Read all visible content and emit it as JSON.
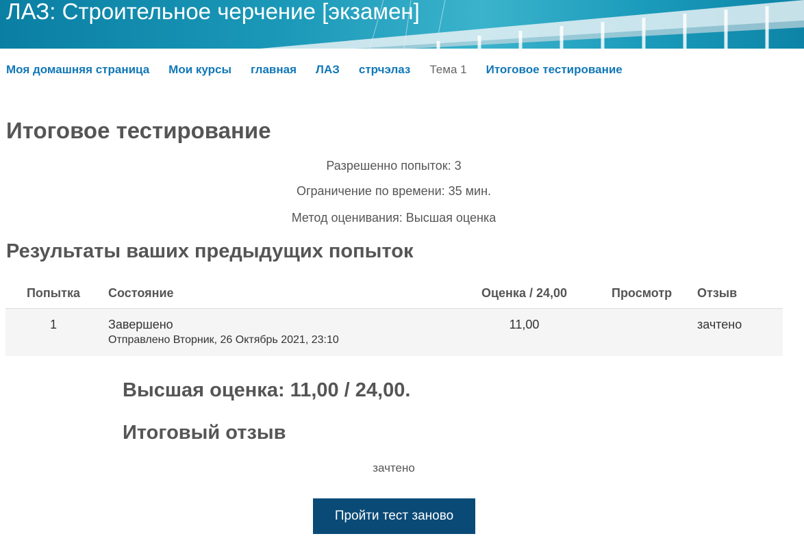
{
  "header": {
    "course_title": "ЛАЗ: Строительное черчение [экзамен]"
  },
  "breadcrumb": [
    {
      "label": "Моя домашняя страница",
      "link": true
    },
    {
      "label": "Мои курсы",
      "link": true
    },
    {
      "label": "главная",
      "link": true
    },
    {
      "label": "ЛАЗ",
      "link": true
    },
    {
      "label": "стрчэлаз",
      "link": true
    },
    {
      "label": "Тема 1",
      "link": false
    },
    {
      "label": "Итоговое тестирование",
      "link": true
    }
  ],
  "page": {
    "title": "Итоговое тестирование",
    "info": {
      "attempts_allowed": "Разрешенно попыток: 3",
      "time_limit": "Ограничение по времени: 35 мин.",
      "grading_method": "Метод оценивания: Высшая оценка"
    }
  },
  "results": {
    "title": "Результаты ваших предыдущих попыток",
    "columns": {
      "attempt": "Попытка",
      "state": "Состояние",
      "grade": "Оценка / 24,00",
      "review": "Просмотр",
      "feedback": "Отзыв"
    },
    "rows": [
      {
        "attempt": "1",
        "state": "Завершено",
        "submitted": "Отправлено Вторник, 26 Октябрь 2021, 23:10",
        "grade": "11,00",
        "review": "",
        "feedback": "зачтено"
      }
    ]
  },
  "summary": {
    "best_grade": "Высшая оценка: 11,00 / 24,00.",
    "overall_feedback_title": "Итоговый отзыв",
    "overall_feedback": "зачтено"
  },
  "actions": {
    "retake_label": "Пройти тест заново"
  },
  "colors": {
    "link": "#1177b7",
    "button": "#0a4a77",
    "header_sea": "#1b98b8"
  }
}
